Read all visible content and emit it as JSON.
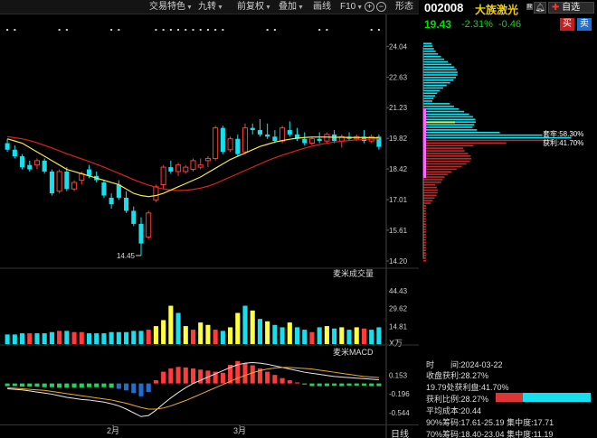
{
  "toolbar": {
    "items": [
      {
        "label": "交易特色",
        "dropdown": true
      },
      {
        "label": "九转",
        "dropdown": true
      },
      {
        "label": "前复权",
        "dropdown": true
      },
      {
        "label": "叠加",
        "dropdown": true
      },
      {
        "label": "画线",
        "dropdown": false
      },
      {
        "label": "F10",
        "dropdown": true
      },
      {
        "label": "形态",
        "dropdown": false
      }
    ],
    "zoom_in": "+",
    "zoom_out": "−"
  },
  "stock": {
    "code": "002008",
    "name": "大族激光",
    "badge": "R",
    "price": "19.43",
    "change_pct": "-2.31%",
    "change": "-0.46",
    "watch_label": "自选",
    "buy_label": "买",
    "sell_label": "卖"
  },
  "colors": {
    "up": "#ff3b3b",
    "down": "#16e0ee",
    "ma_fast": "#f5e642",
    "ma_slow": "#e02020",
    "volume_up": "#ffff3f",
    "chip_profit": "#16e0ee",
    "chip_loss": "#c22a2a"
  },
  "chart_data": [
    {
      "type": "candlestick",
      "title": "",
      "ylim": [
        14.2,
        24.3
      ],
      "y_ticks": [
        "24.04",
        "22.63",
        "21.23",
        "19.82",
        "18.42",
        "17.01",
        "15.61",
        "14.20"
      ],
      "x_ticks": [
        "2月",
        "3月"
      ],
      "annotations": {
        "low_label": "14.45"
      },
      "candles": [
        {
          "o": 19.6,
          "h": 19.8,
          "l": 19.2,
          "c": 19.3
        },
        {
          "o": 19.3,
          "h": 19.5,
          "l": 18.9,
          "c": 19.0
        },
        {
          "o": 19.0,
          "h": 19.1,
          "l": 18.4,
          "c": 18.5
        },
        {
          "o": 18.6,
          "h": 18.8,
          "l": 18.3,
          "c": 18.4
        },
        {
          "o": 18.6,
          "h": 18.9,
          "l": 18.4,
          "c": 18.8
        },
        {
          "o": 18.8,
          "h": 18.9,
          "l": 18.2,
          "c": 18.3
        },
        {
          "o": 18.3,
          "h": 18.4,
          "l": 17.2,
          "c": 17.3
        },
        {
          "o": 17.4,
          "h": 18.4,
          "l": 17.3,
          "c": 18.3
        },
        {
          "o": 18.3,
          "h": 18.5,
          "l": 17.4,
          "c": 17.5
        },
        {
          "o": 17.5,
          "h": 17.9,
          "l": 17.4,
          "c": 17.8
        },
        {
          "o": 17.9,
          "h": 18.3,
          "l": 17.7,
          "c": 18.2
        },
        {
          "o": 18.4,
          "h": 18.6,
          "l": 18.0,
          "c": 18.1
        },
        {
          "o": 18.1,
          "h": 18.3,
          "l": 17.8,
          "c": 17.9
        },
        {
          "o": 17.8,
          "h": 17.9,
          "l": 17.1,
          "c": 17.2
        },
        {
          "o": 17.1,
          "h": 17.3,
          "l": 16.6,
          "c": 16.8
        },
        {
          "o": 17.7,
          "h": 17.9,
          "l": 17.0,
          "c": 17.1
        },
        {
          "o": 17.1,
          "h": 17.4,
          "l": 16.4,
          "c": 16.5
        },
        {
          "o": 16.5,
          "h": 16.7,
          "l": 15.8,
          "c": 15.9
        },
        {
          "o": 15.9,
          "h": 16.2,
          "l": 14.45,
          "c": 15.0
        },
        {
          "o": 15.3,
          "h": 16.5,
          "l": 15.2,
          "c": 16.4
        },
        {
          "o": 17.0,
          "h": 17.7,
          "l": 16.9,
          "c": 17.6
        },
        {
          "o": 17.7,
          "h": 18.6,
          "l": 17.5,
          "c": 18.5
        },
        {
          "o": 18.5,
          "h": 18.8,
          "l": 18.2,
          "c": 18.3
        },
        {
          "o": 18.3,
          "h": 18.7,
          "l": 18.1,
          "c": 18.6
        },
        {
          "o": 18.3,
          "h": 18.6,
          "l": 18.2,
          "c": 18.5
        },
        {
          "o": 18.4,
          "h": 18.9,
          "l": 18.3,
          "c": 18.8
        },
        {
          "o": 18.5,
          "h": 18.9,
          "l": 18.4,
          "c": 18.6
        },
        {
          "o": 18.8,
          "h": 19.0,
          "l": 18.5,
          "c": 18.9
        },
        {
          "o": 18.9,
          "h": 20.4,
          "l": 18.8,
          "c": 20.3
        },
        {
          "o": 20.3,
          "h": 20.4,
          "l": 19.1,
          "c": 19.2
        },
        {
          "o": 19.3,
          "h": 19.9,
          "l": 19.2,
          "c": 19.8
        },
        {
          "o": 19.8,
          "h": 20.0,
          "l": 19.0,
          "c": 19.1
        },
        {
          "o": 19.2,
          "h": 20.5,
          "l": 19.1,
          "c": 20.3
        },
        {
          "o": 20.3,
          "h": 20.5,
          "l": 20.0,
          "c": 20.2
        },
        {
          "o": 20.2,
          "h": 20.7,
          "l": 19.9,
          "c": 20.0
        },
        {
          "o": 20.0,
          "h": 20.5,
          "l": 19.8,
          "c": 19.9
        },
        {
          "o": 19.9,
          "h": 20.2,
          "l": 19.6,
          "c": 19.7
        },
        {
          "o": 19.7,
          "h": 20.4,
          "l": 19.6,
          "c": 20.3
        },
        {
          "o": 20.2,
          "h": 20.6,
          "l": 19.9,
          "c": 20.0
        },
        {
          "o": 20.0,
          "h": 20.3,
          "l": 19.7,
          "c": 19.8
        },
        {
          "o": 19.8,
          "h": 20.1,
          "l": 19.5,
          "c": 19.6
        },
        {
          "o": 19.6,
          "h": 19.9,
          "l": 19.5,
          "c": 19.8
        },
        {
          "o": 19.8,
          "h": 20.1,
          "l": 19.6,
          "c": 19.7
        },
        {
          "o": 19.7,
          "h": 20.1,
          "l": 19.6,
          "c": 20.0
        },
        {
          "o": 20.0,
          "h": 20.2,
          "l": 19.6,
          "c": 19.7
        },
        {
          "o": 19.7,
          "h": 20.0,
          "l": 19.4,
          "c": 19.9
        },
        {
          "o": 19.9,
          "h": 20.1,
          "l": 19.7,
          "c": 19.8
        },
        {
          "o": 19.8,
          "h": 20.0,
          "l": 19.7,
          "c": 19.9
        },
        {
          "o": 19.9,
          "h": 20.2,
          "l": 19.6,
          "c": 19.7
        },
        {
          "o": 19.7,
          "h": 20.0,
          "l": 19.6,
          "c": 19.9
        },
        {
          "o": 19.9,
          "h": 20.0,
          "l": 19.3,
          "c": 19.43
        }
      ],
      "ma_fast": [
        19.8,
        19.7,
        19.6,
        19.4,
        19.2,
        19.0,
        18.8,
        18.6,
        18.4,
        18.3,
        18.2,
        18.1,
        18.0,
        17.9,
        17.8,
        17.7,
        17.5,
        17.3,
        17.2,
        17.15,
        17.2,
        17.3,
        17.45,
        17.6,
        17.75,
        17.9,
        18.05,
        18.25,
        18.45,
        18.65,
        18.85,
        19.0,
        19.15,
        19.3,
        19.45,
        19.55,
        19.65,
        19.72,
        19.78,
        19.83,
        19.86,
        19.88,
        19.88,
        19.88,
        19.87,
        19.87,
        19.86,
        19.86,
        19.86,
        19.85,
        19.85
      ],
      "ma_slow": [
        19.9,
        19.85,
        19.8,
        19.72,
        19.62,
        19.5,
        19.38,
        19.25,
        19.12,
        19.0,
        18.88,
        18.76,
        18.63,
        18.5,
        18.36,
        18.22,
        18.08,
        17.93,
        17.8,
        17.68,
        17.58,
        17.5,
        17.45,
        17.43,
        17.44,
        17.48,
        17.54,
        17.63,
        17.75,
        17.9,
        18.05,
        18.2,
        18.35,
        18.5,
        18.65,
        18.8,
        18.93,
        19.05,
        19.16,
        19.27,
        19.37,
        19.46,
        19.54,
        19.6,
        19.65,
        19.69,
        19.72,
        19.75,
        19.77,
        19.79,
        19.8
      ]
    },
    {
      "type": "bar",
      "title": "麦米成交量",
      "unit_label": "X万",
      "y_ticks": [
        "44.43",
        "29.62",
        "14.81"
      ],
      "values": [
        8,
        8,
        9,
        9,
        9,
        9,
        10,
        11,
        11,
        10,
        10,
        9,
        9,
        9,
        10,
        10,
        10,
        11,
        11,
        12,
        15,
        20,
        32,
        26,
        15,
        12,
        18,
        16,
        12,
        11,
        14,
        26,
        32,
        28,
        21,
        19,
        16,
        14,
        18,
        14,
        12,
        10,
        14,
        15,
        13,
        14,
        12,
        14,
        13,
        12,
        14
      ],
      "up": [
        false,
        false,
        false,
        true,
        false,
        false,
        false,
        true,
        false,
        true,
        true,
        false,
        false,
        false,
        false,
        false,
        false,
        false,
        false,
        true,
        true,
        true,
        true,
        false,
        true,
        true,
        true,
        true,
        true,
        false,
        true,
        true,
        false,
        true,
        false,
        true,
        false,
        false,
        true,
        false,
        false,
        true,
        false,
        true,
        false,
        true,
        false,
        true,
        true,
        false,
        false
      ]
    },
    {
      "type": "bar",
      "title": "麦米MACD",
      "y_ticks": [
        "0.153",
        "-0.196",
        "-0.544"
      ],
      "hist": [
        -0.05,
        -0.05,
        -0.06,
        -0.06,
        -0.06,
        -0.07,
        -0.07,
        -0.08,
        -0.08,
        -0.08,
        -0.08,
        -0.07,
        -0.07,
        -0.07,
        -0.08,
        -0.1,
        -0.13,
        -0.18,
        -0.24,
        -0.16,
        0.06,
        0.22,
        0.28,
        0.31,
        0.3,
        0.28,
        0.26,
        0.24,
        0.22,
        0.2,
        0.35,
        0.42,
        0.38,
        0.34,
        0.28,
        0.22,
        0.16,
        0.1,
        0.06,
        0.02,
        -0.02,
        -0.05,
        -0.05,
        -0.05,
        -0.04,
        -0.05,
        -0.04,
        -0.04,
        -0.04,
        -0.05,
        -0.05
      ],
      "dif": [
        -0.1,
        -0.11,
        -0.12,
        -0.14,
        -0.16,
        -0.18,
        -0.2,
        -0.23,
        -0.26,
        -0.28,
        -0.3,
        -0.31,
        -0.33,
        -0.35,
        -0.38,
        -0.42,
        -0.48,
        -0.55,
        -0.62,
        -0.6,
        -0.5,
        -0.38,
        -0.27,
        -0.17,
        -0.08,
        0.0,
        0.06,
        0.12,
        0.18,
        0.24,
        0.3,
        0.35,
        0.38,
        0.39,
        0.38,
        0.36,
        0.33,
        0.3,
        0.27,
        0.24,
        0.21,
        0.19,
        0.17,
        0.15,
        0.13,
        0.12,
        0.11,
        0.1,
        0.09,
        0.08,
        0.07
      ],
      "dea": [
        -0.08,
        -0.09,
        -0.1,
        -0.11,
        -0.12,
        -0.13,
        -0.15,
        -0.17,
        -0.19,
        -0.21,
        -0.23,
        -0.25,
        -0.27,
        -0.29,
        -0.31,
        -0.34,
        -0.37,
        -0.41,
        -0.45,
        -0.48,
        -0.48,
        -0.46,
        -0.42,
        -0.37,
        -0.32,
        -0.26,
        -0.2,
        -0.14,
        -0.08,
        -0.02,
        0.04,
        0.1,
        0.15,
        0.2,
        0.24,
        0.27,
        0.29,
        0.3,
        0.3,
        0.29,
        0.28,
        0.27,
        0.25,
        0.23,
        0.21,
        0.19,
        0.17,
        0.15,
        0.13,
        0.12,
        0.11
      ]
    }
  ],
  "chip_chart": {
    "labels": {
      "profit": "获利:41.70%",
      "cost": "套牢:58.30%"
    }
  },
  "chip_info": {
    "time": "时　　间:2024-03-22",
    "close_profit": "收盘获利:28.27%",
    "profit_at": "19.79处获利盘:41.70%",
    "profit_ratio": "获利比例:28.27%",
    "profit_ratio_value": 0.2827,
    "avg_cost": "平均成本:20.44",
    "range90": "90%筹码:17.61-25.19",
    "conc90": "集中度:17.71",
    "range70": "70%筹码:18.40-23.04",
    "conc70": "集中度:11.19"
  },
  "bottom": {
    "daily_label": "日线"
  }
}
